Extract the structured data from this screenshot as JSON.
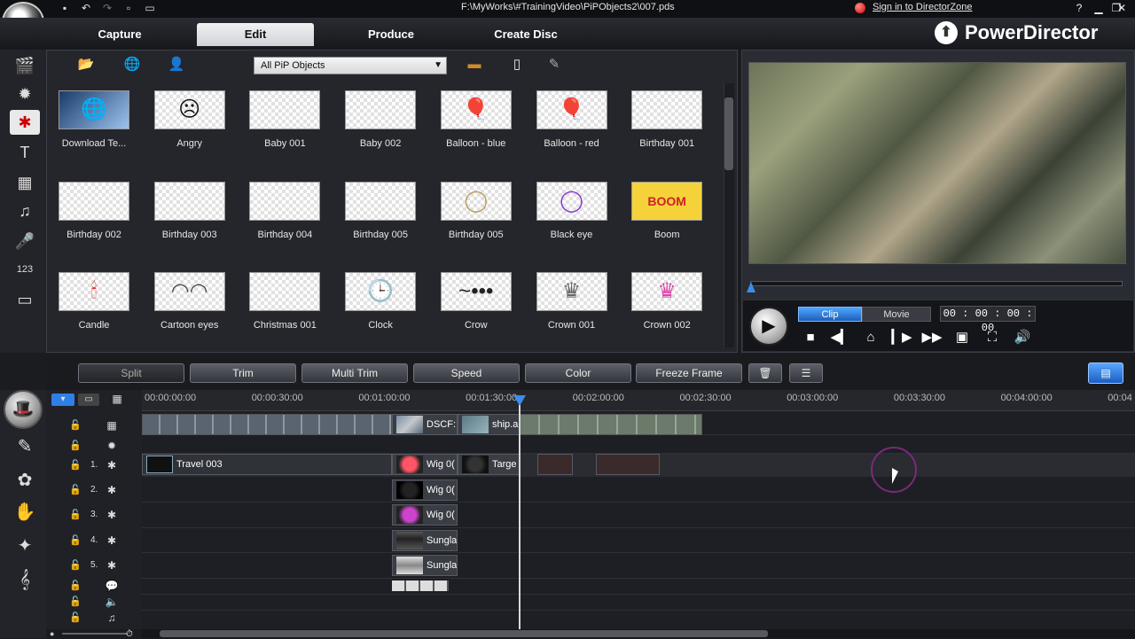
{
  "window": {
    "file_path": "F:\\MyWorks\\#TrainingVideo\\PiPObjects2\\007.pds",
    "sign_in": "Sign in to DirectorZone",
    "brand": "PowerDirector",
    "quick_access_icons": [
      "save-icon",
      "undo-icon",
      "redo-icon",
      "new-icon",
      "open-icon"
    ],
    "window_controls": [
      "help-icon",
      "minimize-icon",
      "restore-icon",
      "close-icon"
    ]
  },
  "mode_tabs": [
    "Capture",
    "Edit",
    "Produce",
    "Create Disc"
  ],
  "active_mode": "Edit",
  "rooms": [
    {
      "name": "media-room-icon",
      "glyph": "🎬"
    },
    {
      "name": "effect-room-icon",
      "glyph": "✹"
    },
    {
      "name": "pip-objects-room-icon",
      "glyph": "✱",
      "active": true
    },
    {
      "name": "title-room-icon",
      "glyph": "T"
    },
    {
      "name": "transition-room-icon",
      "glyph": "▦"
    },
    {
      "name": "audio-mixing-room-icon",
      "glyph": "♫"
    },
    {
      "name": "voiceover-room-icon",
      "glyph": "🎤"
    },
    {
      "name": "chapter-room-icon",
      "glyph": "123"
    },
    {
      "name": "subtitle-room-icon",
      "glyph": "▭"
    }
  ],
  "library": {
    "category": "All PiP Objects",
    "toolbar_icons": [
      "import-folder-icon",
      "download-web-icon",
      "directorzone-icon",
      "pip-designer-icon",
      "new-item-icon",
      "paint-tool-icon"
    ],
    "items": [
      {
        "label": "Download Te...",
        "glyph": "🌐"
      },
      {
        "label": "Angry",
        "glyph": "☹"
      },
      {
        "label": "Baby 001",
        "glyph": ""
      },
      {
        "label": "Baby 002",
        "glyph": ""
      },
      {
        "label": "Balloon - blue",
        "glyph": "🎈"
      },
      {
        "label": "Balloon - red",
        "glyph": "🎈"
      },
      {
        "label": "Birthday 001",
        "glyph": ""
      },
      {
        "label": "Birthday 002",
        "glyph": ""
      },
      {
        "label": "Birthday 003",
        "glyph": ""
      },
      {
        "label": "Birthday 004",
        "glyph": ""
      },
      {
        "label": "Birthday 005",
        "glyph": ""
      },
      {
        "label": "Birthday 005",
        "glyph": "◯"
      },
      {
        "label": "Black eye",
        "glyph": "◯"
      },
      {
        "label": "Boom",
        "glyph": "BOOM"
      },
      {
        "label": "Candle",
        "glyph": "🕯"
      },
      {
        "label": "Cartoon eyes",
        "glyph": "◠◠"
      },
      {
        "label": "Christmas 001",
        "glyph": ""
      },
      {
        "label": "Clock",
        "glyph": "🕒"
      },
      {
        "label": "Crow",
        "glyph": "~•••"
      },
      {
        "label": "Crown 001",
        "glyph": "♛"
      },
      {
        "label": "Crown 002",
        "glyph": "♛"
      }
    ]
  },
  "preview": {
    "modes": [
      "Clip",
      "Movie"
    ],
    "active_mode": "Clip",
    "timecode": "00 : 00 : 00 : 00",
    "position_percent": 0,
    "controls": [
      "stop-icon",
      "previous-frame-icon",
      "take-snapshot-icon",
      "next-frame-icon",
      "fast-forward-icon",
      "preview-quality-icon",
      "fullscreen-icon",
      "volume-icon"
    ]
  },
  "timeline_toolbar": {
    "buttons": [
      "Split",
      "Trim",
      "Multi Trim",
      "Speed",
      "Color",
      "Freeze Frame"
    ],
    "extra_icons": [
      "delete-icon",
      "keyframe-icon",
      "timeline-mode-icon"
    ]
  },
  "timeline": {
    "ruler_ticks": [
      "00:00:00:00",
      "00:00:30:00",
      "00:01:00:00",
      "00:01:30:00",
      "00:02:00:00",
      "00:02:30:00",
      "00:03:00:00",
      "00:03:30:00",
      "00:04:00:00",
      "00:04"
    ],
    "track_numbers": [
      "1.",
      "2.",
      "3.",
      "4.",
      "5."
    ],
    "clips": {
      "video_dscf": "DSCF:",
      "video_ship": "ship.a",
      "pip1_travel": "Travel 003",
      "pip1_wig": "Wig 0(",
      "pip1_target": "Targe",
      "pip2_wig": "Wig 0(",
      "pip3_wig": "Wig 0(",
      "pip4_sungla": "Sungla",
      "pip5_sungla": "Sungla"
    }
  }
}
